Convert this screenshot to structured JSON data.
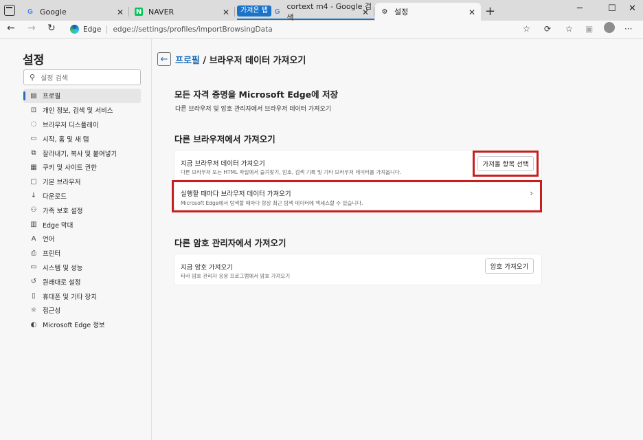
{
  "tabs": [
    {
      "title": "Google",
      "favicon": "google-icon"
    },
    {
      "title": "NAVER",
      "favicon": "naver-icon"
    },
    {
      "title": "cortext m4 - Google 검색",
      "favicon": "google-icon"
    },
    {
      "title": "설정",
      "favicon": "gear-icon"
    }
  ],
  "tab_group_label": "가져온 탭",
  "address": {
    "brand": "Edge",
    "url": "edge://settings/profiles/importBrowsingData"
  },
  "sidebar": {
    "title": "설정",
    "search_placeholder": "설정 검색",
    "items": [
      {
        "label": "프로필",
        "icon": "profile-icon",
        "selected": true
      },
      {
        "label": "개인 정보, 검색 및 서비스",
        "icon": "lock-icon"
      },
      {
        "label": "브라우저 디스플레이",
        "icon": "palette-icon"
      },
      {
        "label": "시작, 홈 및 새 탭",
        "icon": "home-icon"
      },
      {
        "label": "잘라내기, 복사 및 붙여넣기",
        "icon": "clipboard-icon"
      },
      {
        "label": "쿠키 및 사이트 권한",
        "icon": "cookie-icon"
      },
      {
        "label": "기본 브라우저",
        "icon": "browser-icon"
      },
      {
        "label": "다운로드",
        "icon": "download-icon"
      },
      {
        "label": "가족 보호 설정",
        "icon": "family-icon"
      },
      {
        "label": "Edge 막대",
        "icon": "edge-bar-icon"
      },
      {
        "label": "언어",
        "icon": "language-icon"
      },
      {
        "label": "프린터",
        "icon": "printer-icon"
      },
      {
        "label": "시스템 및 성능",
        "icon": "system-icon"
      },
      {
        "label": "원래대로 설정",
        "icon": "reset-icon"
      },
      {
        "label": "휴대폰 및 기타 장치",
        "icon": "phone-icon"
      },
      {
        "label": "접근성",
        "icon": "accessibility-icon"
      },
      {
        "label": "Microsoft Edge 정보",
        "icon": "edge-icon"
      }
    ]
  },
  "main": {
    "breadcrumb_link": "프로필",
    "breadcrumb_current": " / 브라우저 데이터 가져오기",
    "hero_title": "모든 자격 증명을 Microsoft Edge에 저장",
    "hero_sub": "다른 브라우저 및 암호 관리자에서 브라우저 데이터 가져오기",
    "section1_title": "다른 브라우저에서 가져오기",
    "import_now_title": "지금 브라우저 데이터 가져오기",
    "import_now_sub": "다른 브라우저 또는 HTML 파일에서 즐겨찾기, 암호, 검색 기록 및 기타 브라우저 데이터를 가져옵니다.",
    "import_now_button": "가져올 항목 선택",
    "import_each_title": "실행할 때마다 브라우저 데이터 가져오기",
    "import_each_sub": "Microsoft Edge에서 탐색할 때마다 항상 최근 탐색 데이터에 액세스할 수 있습니다.",
    "section2_title": "다른 암호 관리자에서 가져오기",
    "pw_title": "지금 암호 가져오기",
    "pw_sub": "타사 암호 관리자 응용 프로그램에서 암호 가져오기",
    "pw_button": "암호 가져오기"
  },
  "colors": {
    "accent": "#1a6bb8",
    "highlight": "#c81e1e",
    "tab_group": "#1a73c9"
  }
}
